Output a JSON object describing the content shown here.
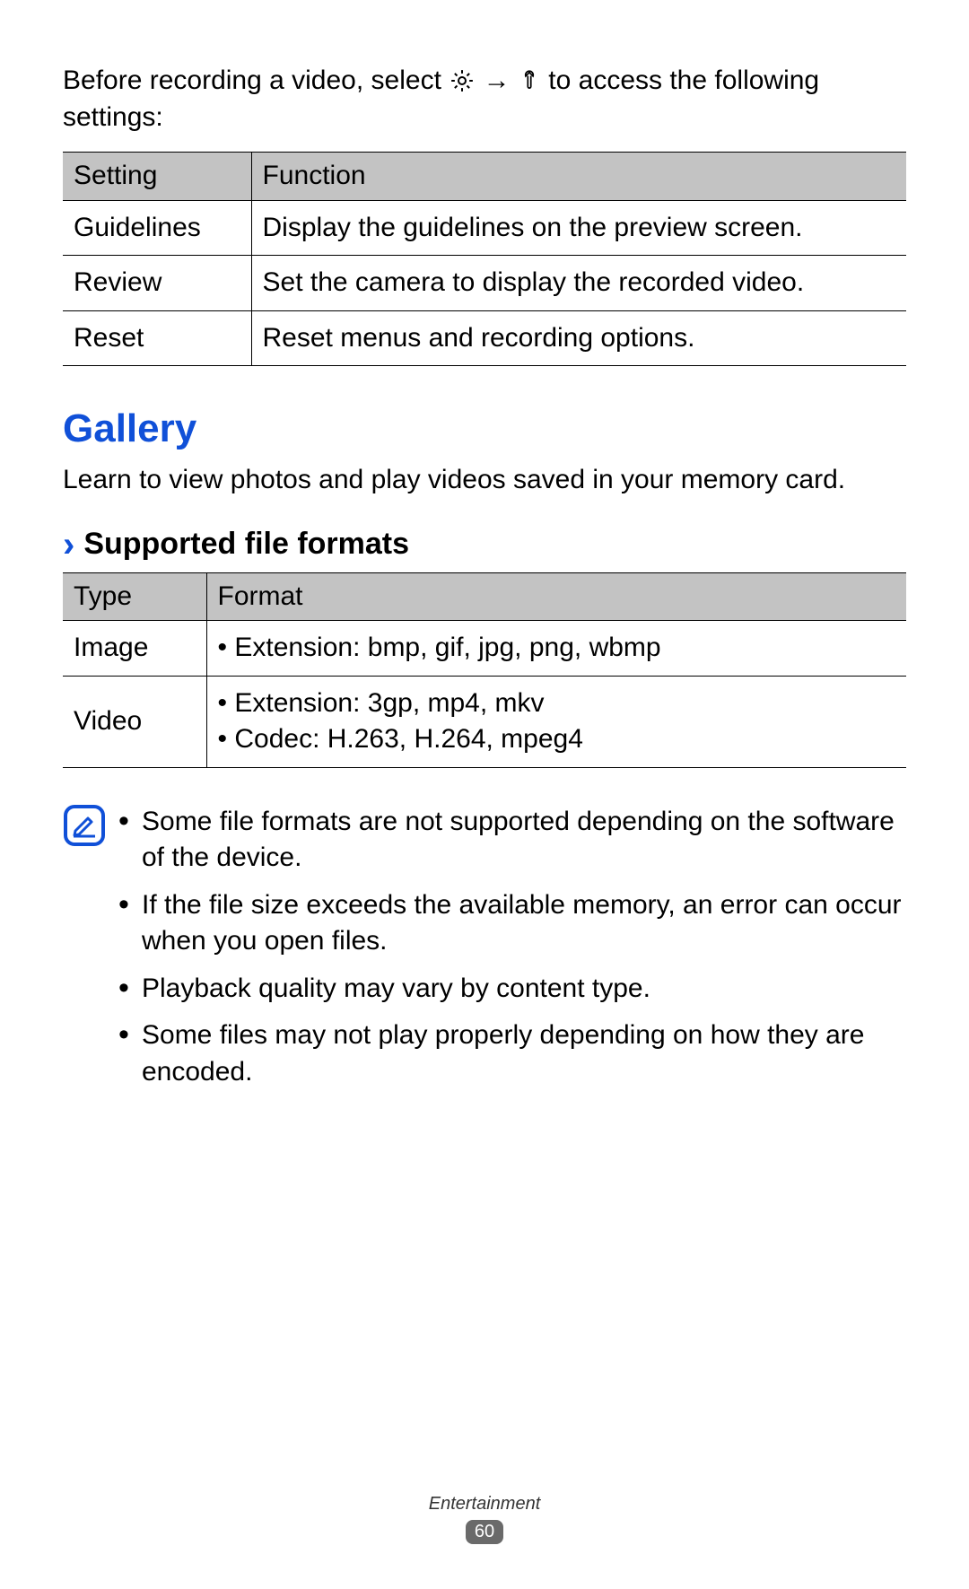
{
  "intro": {
    "prefix": "Before recording a video, select ",
    "arrow": " → ",
    "suffix": " to access the following settings:"
  },
  "settings_table": {
    "headers": {
      "col1": "Setting",
      "col2": "Function"
    },
    "rows": [
      {
        "setting": "Guidelines",
        "function": "Display the guidelines on the preview screen."
      },
      {
        "setting": "Review",
        "function": "Set the camera to display the recorded video."
      },
      {
        "setting": "Reset",
        "function": "Reset menus and recording options."
      }
    ]
  },
  "gallery": {
    "title": "Gallery",
    "desc": "Learn to view photos and play videos saved in your memory card."
  },
  "supported": {
    "chevron": "›",
    "title": "Supported file formats",
    "headers": {
      "col1": "Type",
      "col2": "Format"
    },
    "rows": {
      "image": {
        "type": "Image",
        "bullets": [
          "Extension: bmp, gif, jpg, png, wbmp"
        ]
      },
      "video": {
        "type": "Video",
        "bullets": [
          "Extension: 3gp, mp4, mkv",
          "Codec: H.263, H.264, mpeg4"
        ]
      }
    }
  },
  "notes": [
    "Some file formats are not supported depending on the software of the device.",
    "If the file size exceeds the available memory, an error can occur when you open files.",
    "Playback quality may vary by content type.",
    "Some files may not play properly depending on how they are encoded."
  ],
  "footer": {
    "chapter": "Entertainment",
    "page": "60"
  }
}
